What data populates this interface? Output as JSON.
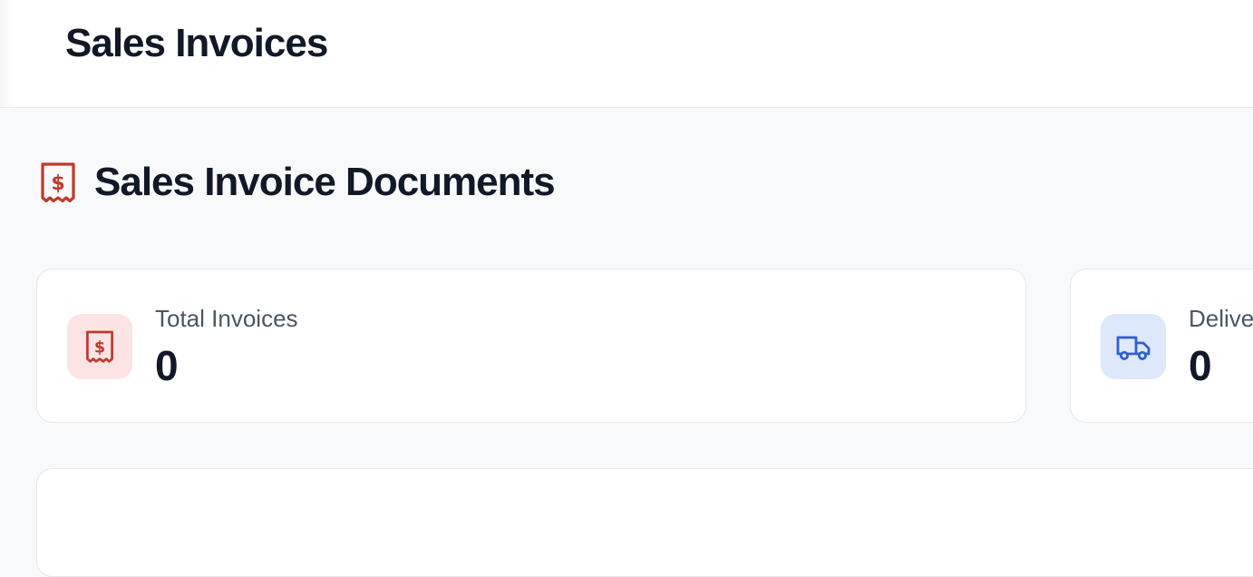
{
  "header": {
    "title": "Sales Invoices"
  },
  "section": {
    "title": "Sales Invoice Documents",
    "icon": "receipt-dollar-icon"
  },
  "stats": [
    {
      "label": "Total Invoices",
      "value": "0",
      "icon": "receipt-dollar-icon",
      "icon_color": "#c0392b",
      "icon_bg": "#fde4e4"
    },
    {
      "label": "Delive",
      "value": "0",
      "icon": "truck-icon",
      "icon_color": "#2f5fd0",
      "icon_bg": "#dde8fb"
    }
  ],
  "colors": {
    "accent_red": "#c0392b",
    "accent_blue": "#2f5fd0"
  }
}
